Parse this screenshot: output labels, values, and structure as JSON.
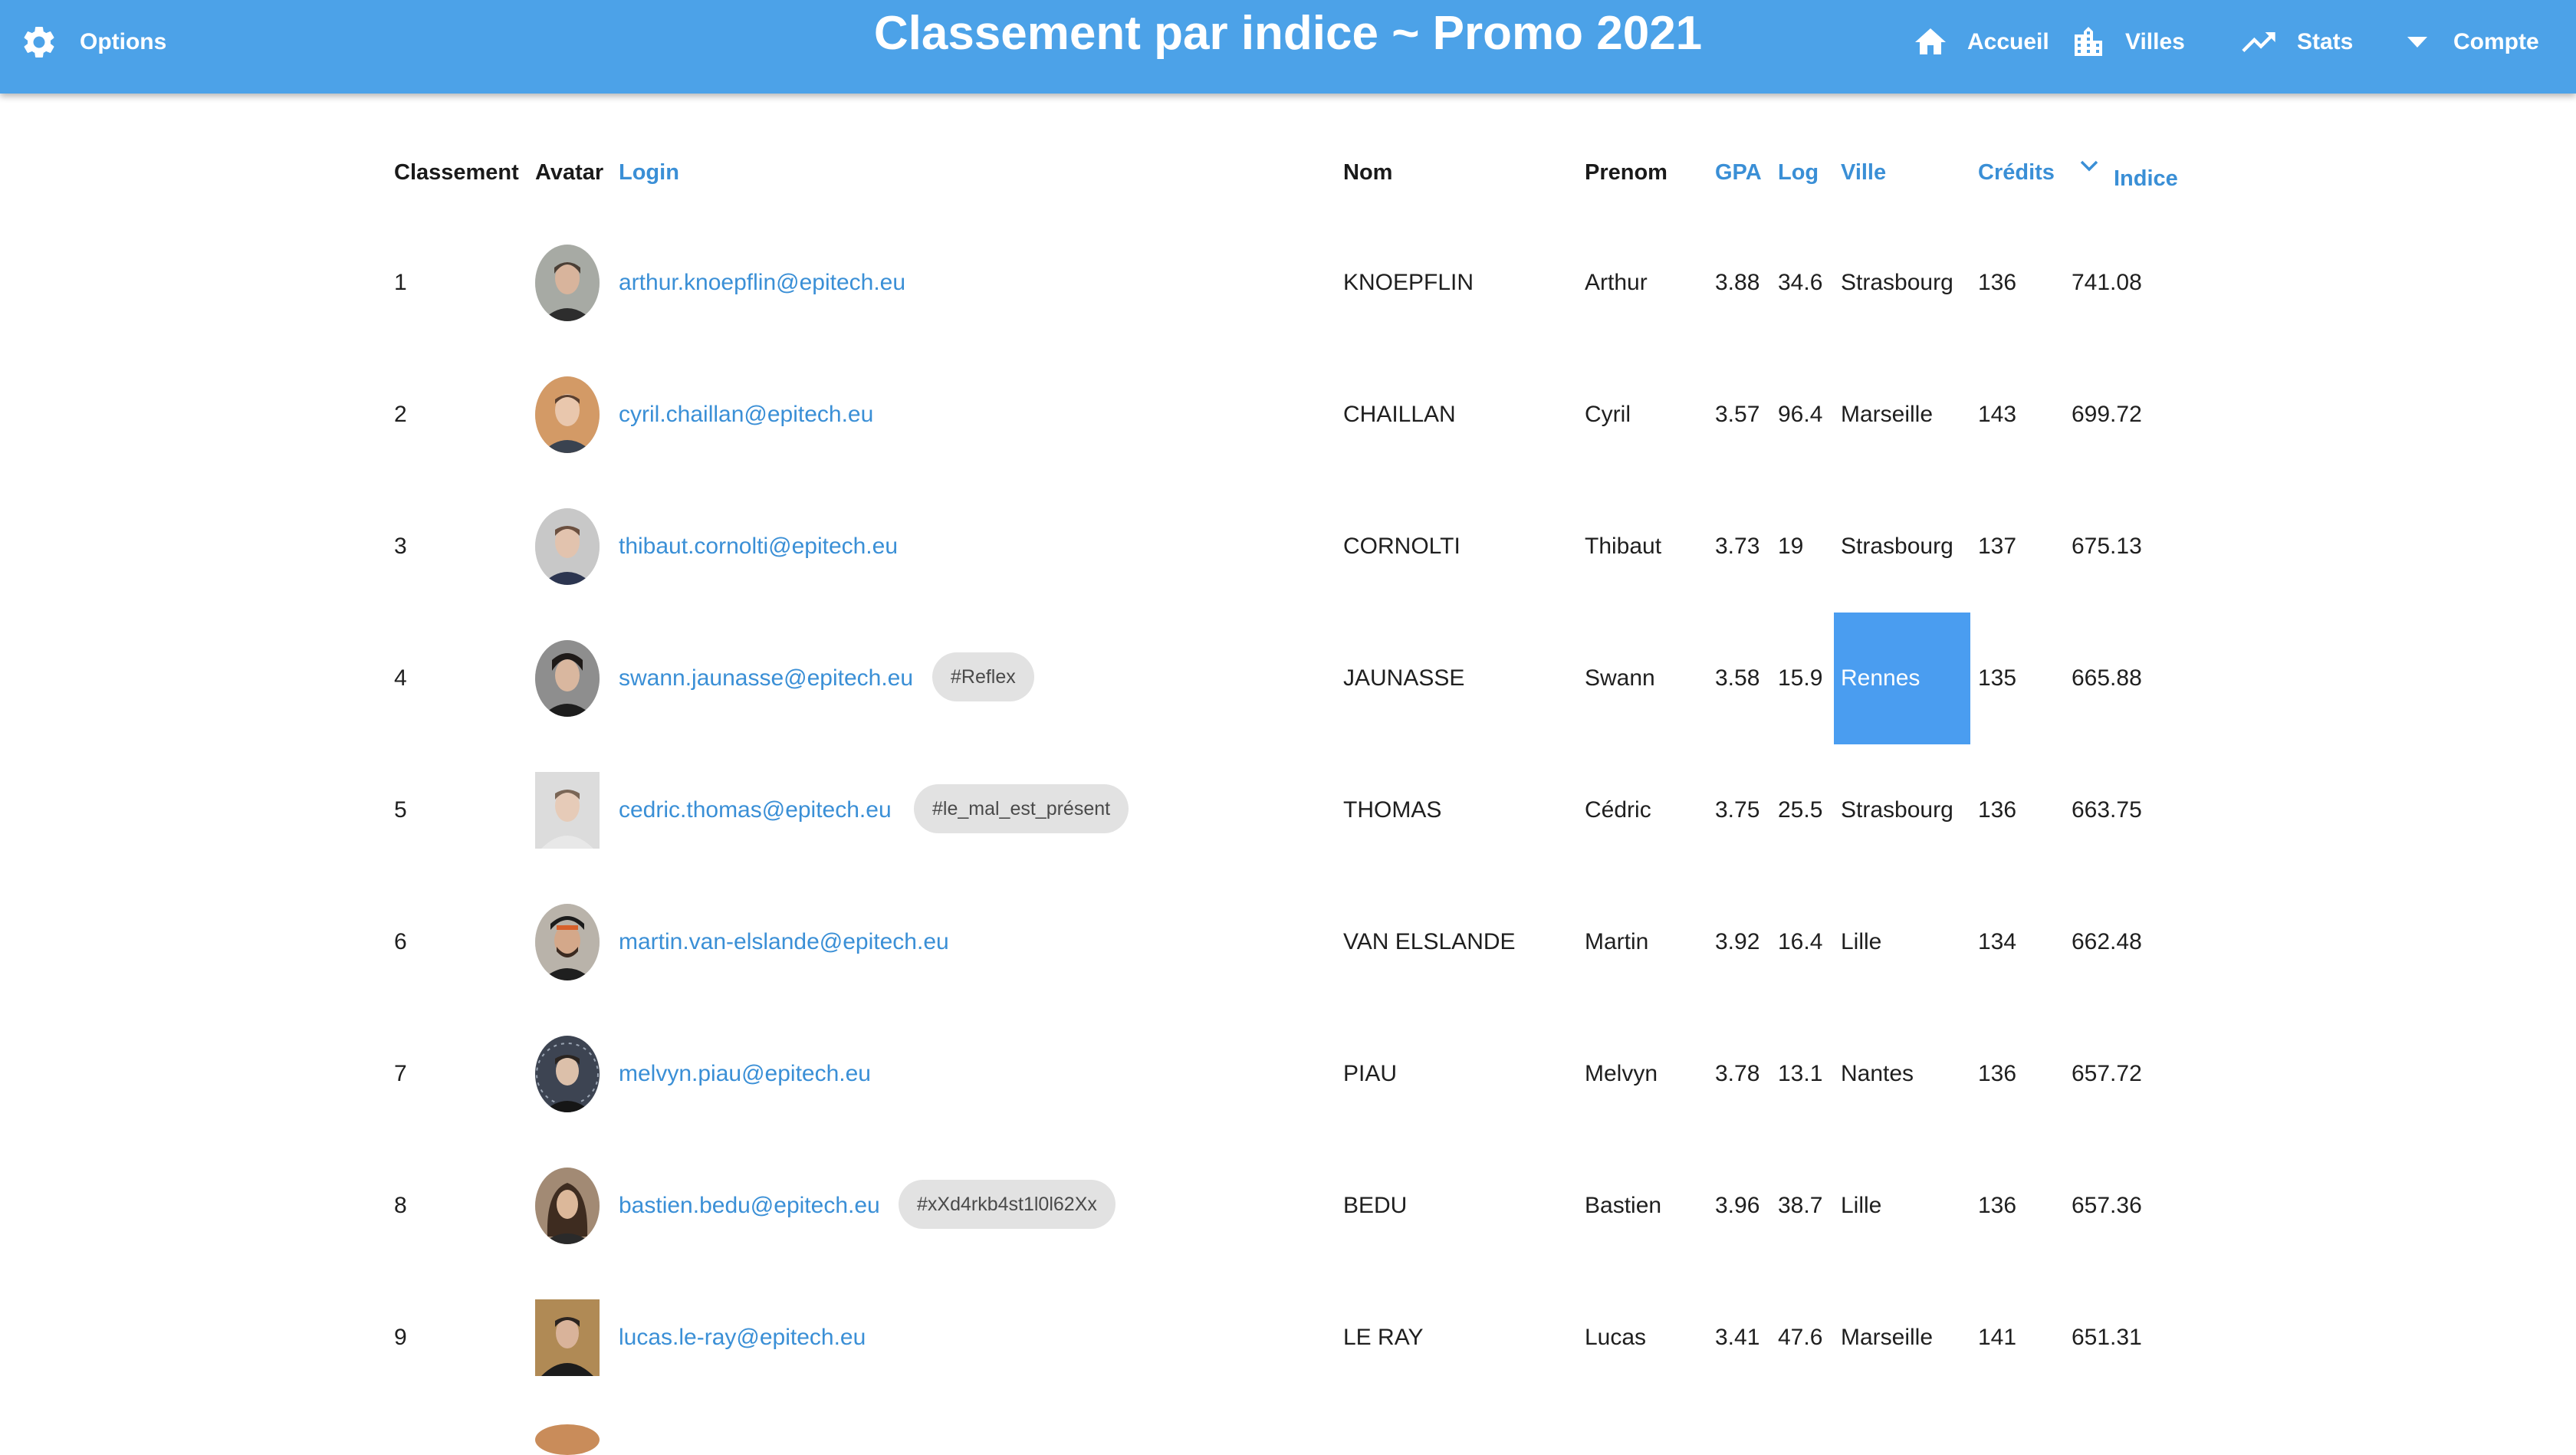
{
  "header": {
    "options_label": "Options",
    "title": "Classement par indice ~ Promo 2021",
    "nav": [
      {
        "label": "Accueil",
        "icon": "home-icon"
      },
      {
        "label": "Villes",
        "icon": "city-icon"
      },
      {
        "label": "Stats",
        "icon": "trending-up-icon"
      },
      {
        "label": "Compte",
        "icon": "caret-down-icon"
      }
    ],
    "colors": {
      "bar": "#4ca2e8",
      "text": "#ffffff"
    }
  },
  "table": {
    "columns": {
      "classement": "Classement",
      "avatar": "Avatar",
      "login": "Login",
      "nom": "Nom",
      "prenom": "Prenom",
      "gpa": "GPA",
      "log": "Log",
      "ville": "Ville",
      "credits": "Crédits",
      "indice": "Indice"
    },
    "sorted_by": "Indice",
    "accent_color": "#3a8fd6",
    "highlight_color": "#4a9df0",
    "rows": [
      {
        "rank": "1",
        "login": "arthur.knoepflin@epitech.eu",
        "tag": "",
        "nom": "KNOEPFLIN",
        "prenom": "Arthur",
        "gpa": "3.88",
        "log": "34.6",
        "ville": "Strasbourg",
        "credits": "136",
        "indice": "741.08"
      },
      {
        "rank": "2",
        "login": "cyril.chaillan@epitech.eu",
        "tag": "",
        "nom": "CHAILLAN",
        "prenom": "Cyril",
        "gpa": "3.57",
        "log": "96.4",
        "ville": "Marseille",
        "credits": "143",
        "indice": "699.72"
      },
      {
        "rank": "3",
        "login": "thibaut.cornolti@epitech.eu",
        "tag": "",
        "nom": "CORNOLTI",
        "prenom": "Thibaut",
        "gpa": "3.73",
        "log": "19",
        "ville": "Strasbourg",
        "credits": "137",
        "indice": "675.13"
      },
      {
        "rank": "4",
        "login": "swann.jaunasse@epitech.eu",
        "tag": "#Reflex",
        "nom": "JAUNASSE",
        "prenom": "Swann",
        "gpa": "3.58",
        "log": "15.9",
        "ville": "Rennes",
        "credits": "135",
        "indice": "665.88"
      },
      {
        "rank": "5",
        "login": "cedric.thomas@epitech.eu",
        "tag": "#le_mal_est_présent",
        "nom": "THOMAS",
        "prenom": "Cédric",
        "gpa": "3.75",
        "log": "25.5",
        "ville": "Strasbourg",
        "credits": "136",
        "indice": "663.75"
      },
      {
        "rank": "6",
        "login": "martin.van-elslande@epitech.eu",
        "tag": "",
        "nom": "VAN ELSLANDE",
        "prenom": "Martin",
        "gpa": "3.92",
        "log": "16.4",
        "ville": "Lille",
        "credits": "134",
        "indice": "662.48"
      },
      {
        "rank": "7",
        "login": "melvyn.piau@epitech.eu",
        "tag": "",
        "nom": "PIAU",
        "prenom": "Melvyn",
        "gpa": "3.78",
        "log": "13.1",
        "ville": "Nantes",
        "credits": "136",
        "indice": "657.72"
      },
      {
        "rank": "8",
        "login": "bastien.bedu@epitech.eu",
        "tag": "#xXd4rkb4st1l0l62Xx",
        "nom": "BEDU",
        "prenom": "Bastien",
        "gpa": "3.96",
        "log": "38.7",
        "ville": "Lille",
        "credits": "136",
        "indice": "657.36"
      },
      {
        "rank": "9",
        "login": "lucas.le-ray@epitech.eu",
        "tag": "",
        "nom": "LE RAY",
        "prenom": "Lucas",
        "gpa": "3.41",
        "log": "47.6",
        "ville": "Marseille",
        "credits": "141",
        "indice": "651.31"
      }
    ]
  }
}
